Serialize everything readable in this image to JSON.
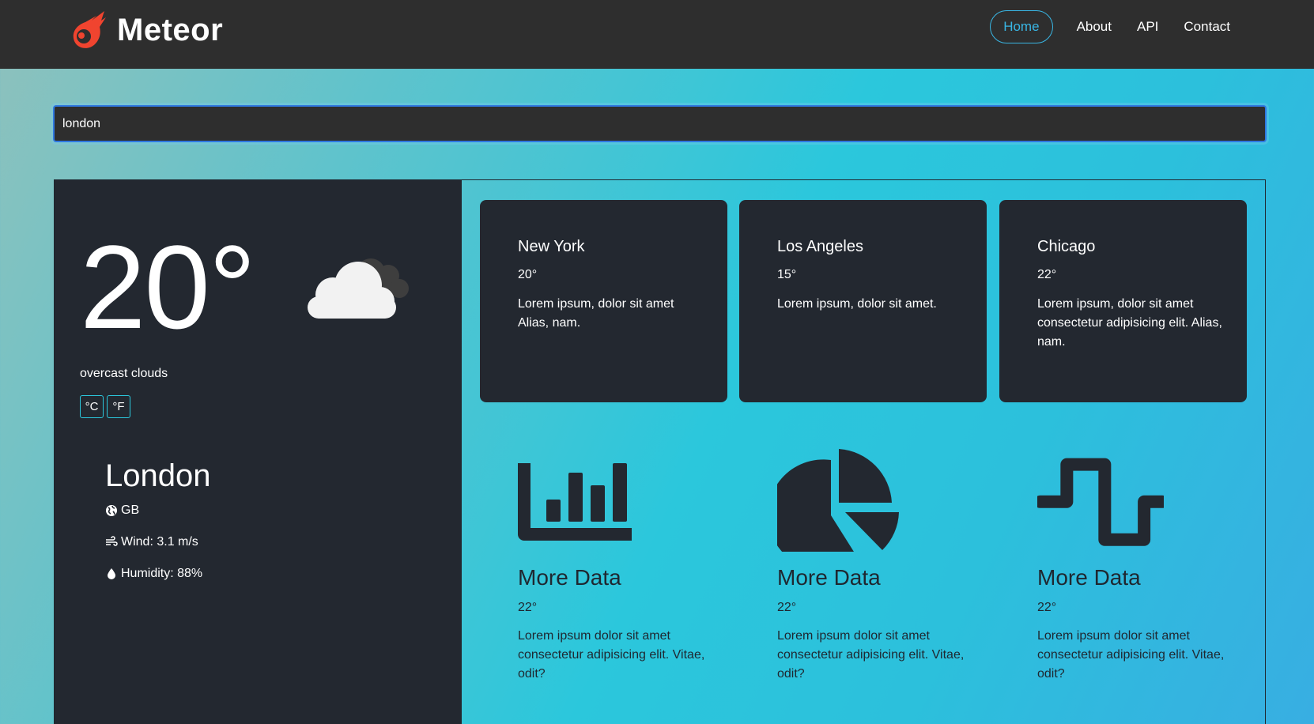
{
  "brand": {
    "name": "Meteor",
    "logo": "meteor-icon",
    "logo_color": "#f0442f"
  },
  "nav": {
    "items": [
      "Home",
      "About",
      "API",
      "Contact"
    ],
    "active": "Home",
    "accent": "#39b6e4"
  },
  "search": {
    "value": "london"
  },
  "current": {
    "temperature": "20°",
    "condition_icon": "overcast-cloud-icon",
    "description": "overcast clouds",
    "units": [
      "°C",
      "°F"
    ],
    "city": "London",
    "country": "GB",
    "wind": "Wind: 3.1 m/s",
    "humidity": "Humidity: 88%"
  },
  "cities": [
    {
      "name": "New York",
      "temp": "20°",
      "text": "Lorem ipsum, dolor sit amet Alias, nam."
    },
    {
      "name": "Los Angeles",
      "temp": "15°",
      "text": "Lorem ipsum, dolor sit amet."
    },
    {
      "name": "Chicago",
      "temp": "22°",
      "text": "Lorem ipsum, dolor sit amet consectetur adipisicing elit. Alias, nam."
    }
  ],
  "more": [
    {
      "icon": "bar-chart-icon",
      "title": "More Data",
      "temp": "22°",
      "text": "Lorem ipsum dolor sit amet consectetur adipisicing elit. Vitae, odit?"
    },
    {
      "icon": "pie-chart-icon",
      "title": "More Data",
      "temp": "22°",
      "text": "Lorem ipsum dolor sit amet consectetur adipisicing elit. Vitae, odit?"
    },
    {
      "icon": "wave-chart-icon",
      "title": "More Data",
      "temp": "22°",
      "text": "Lorem ipsum dolor sit amet consectetur adipisicing elit. Vitae, odit?"
    }
  ]
}
